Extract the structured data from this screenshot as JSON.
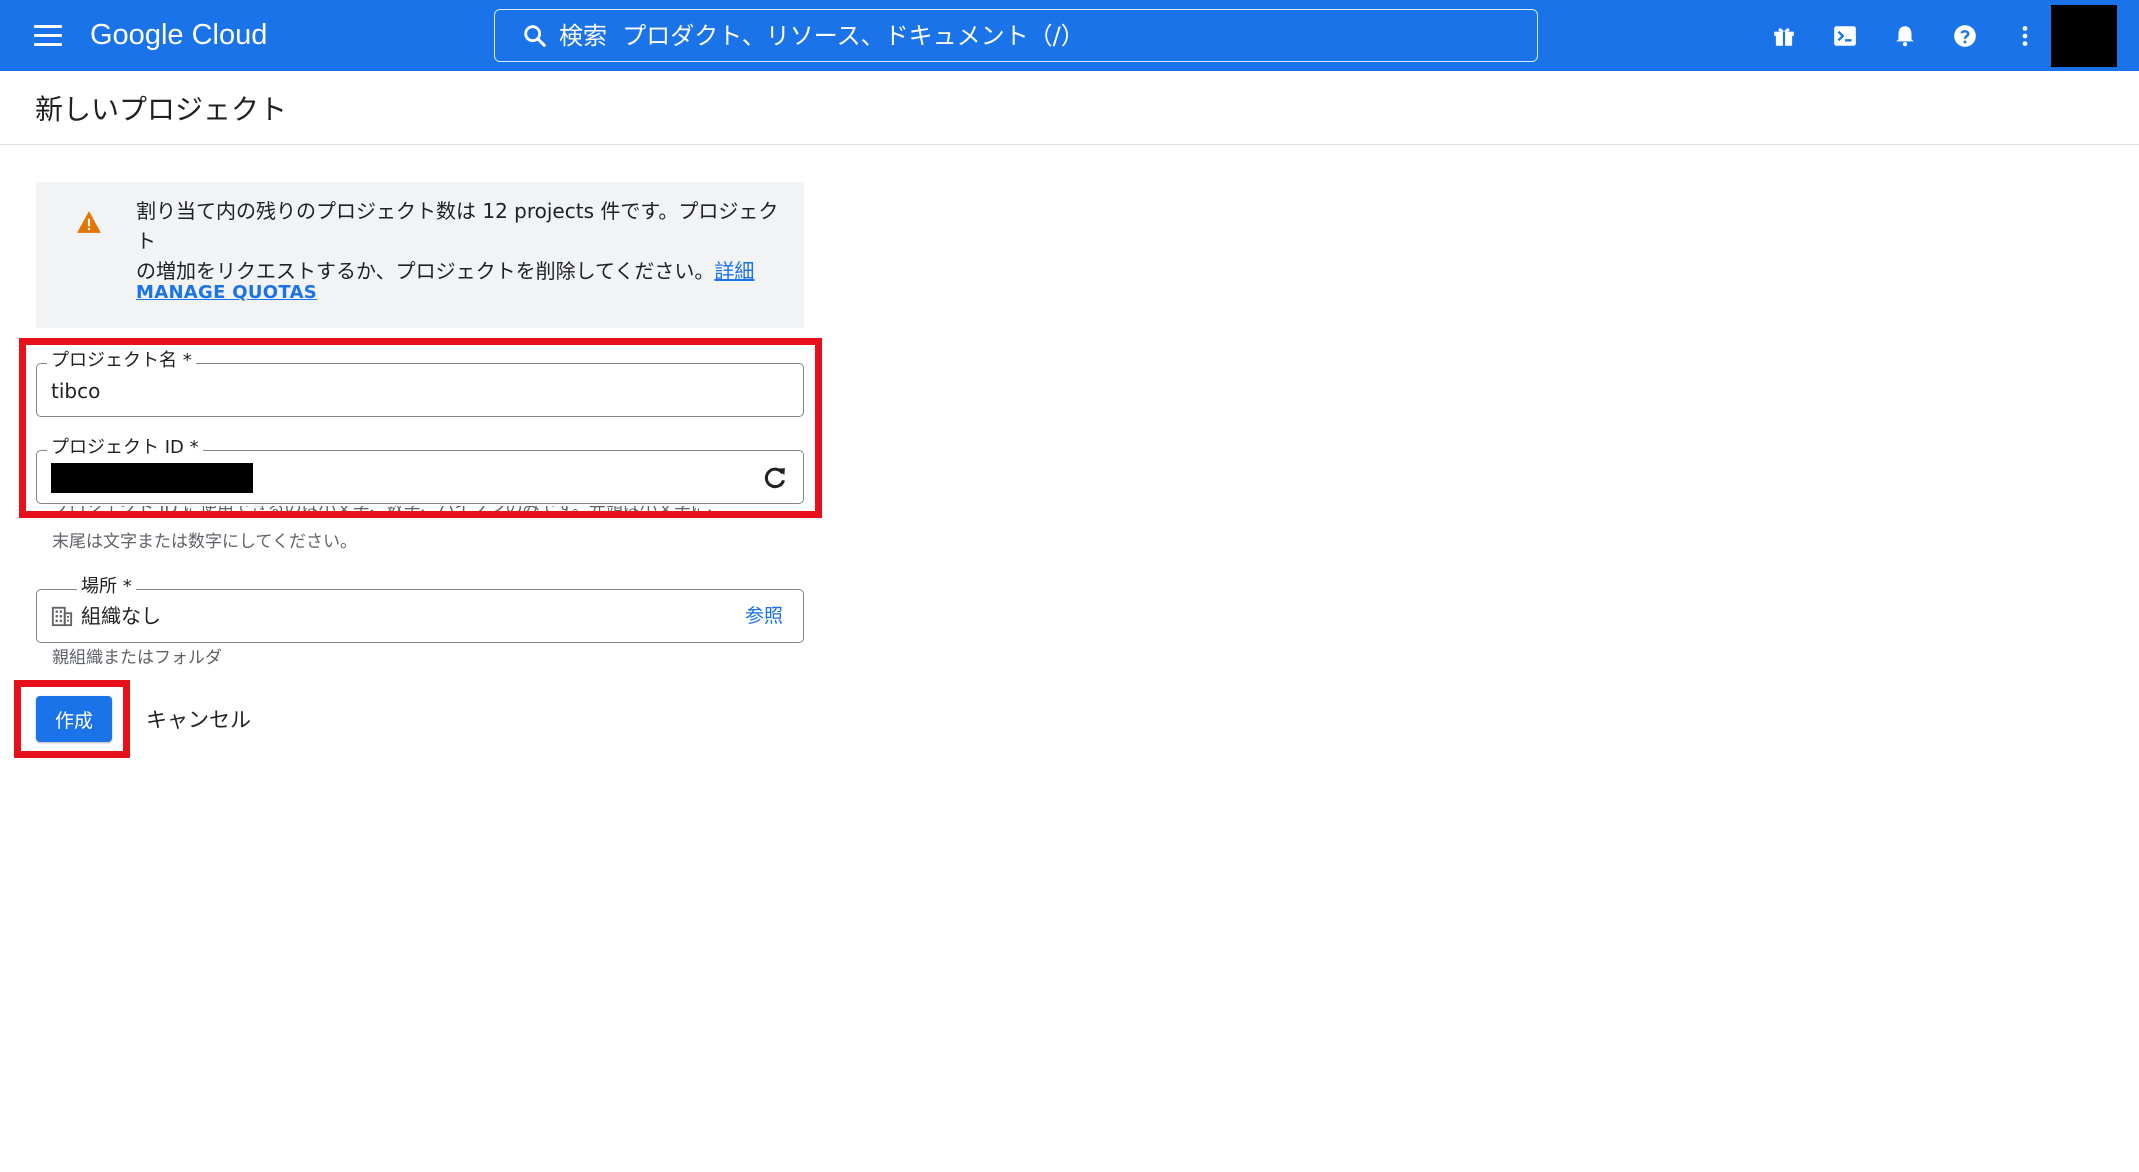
{
  "header": {
    "brand": "Google Cloud",
    "search_placeholder": "検索  プロダクト、リソース、ドキュメント（/）",
    "icons": [
      "menu-icon",
      "search-icon",
      "gift-icon",
      "terminal-icon",
      "bell-icon",
      "help-icon",
      "more-vert-icon"
    ]
  },
  "page": {
    "title": "新しいプロジェクト"
  },
  "notice": {
    "line1": "割り当て内の残りのプロジェクト数は 12 projects 件です。プロジェクト",
    "line2": "の増加をリクエストするか、プロジェクトを削除してください。",
    "details_link": "詳細",
    "manage_quotas": "MANAGE QUOTAS"
  },
  "form": {
    "project_name_label": "プロジェクト名 *",
    "project_name_value": "tibco",
    "project_id_label": "プロジェクト ID *",
    "project_id_helper_line1": "プロジェクト ID に使用できるのは小文字、数字、ハイフンのみです。先頭は小文字に、",
    "project_id_helper_line2": "末尾は文字または数字にしてください。",
    "location_label": "場所 *",
    "location_value": "組織なし",
    "location_browse": "参照",
    "location_helper": "親組織またはフォルダ"
  },
  "actions": {
    "create": "作成",
    "cancel": "キャンセル"
  },
  "colors": {
    "header_bg": "#1a73e8",
    "accent": "#1a73e8",
    "warning": "#e37400",
    "highlight": "#e8101a"
  }
}
